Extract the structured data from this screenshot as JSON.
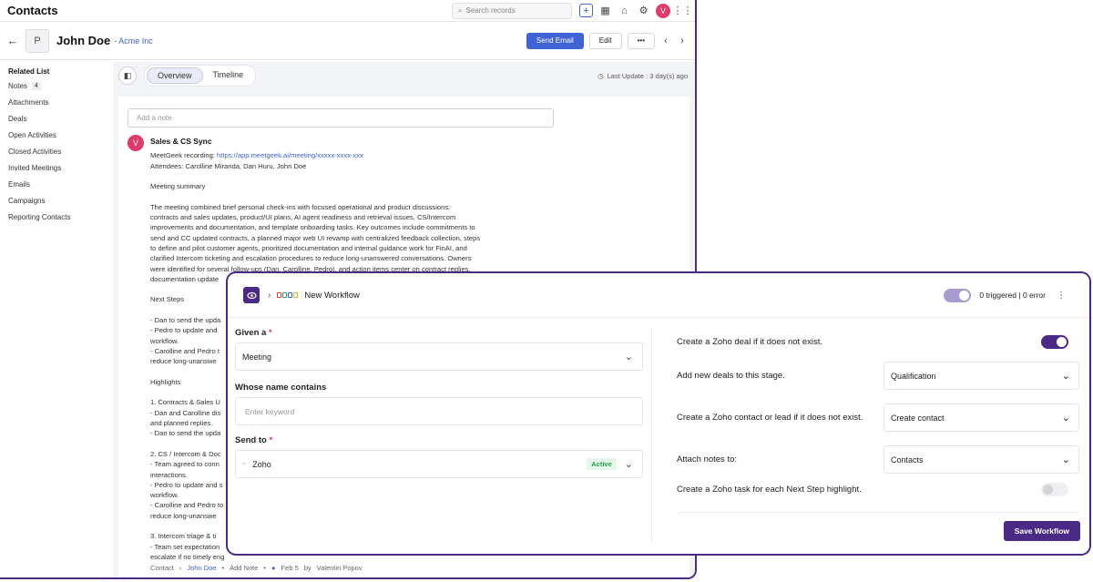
{
  "topbar": {
    "title": "Contacts",
    "search_placeholder": "Search records",
    "avatar_letter": "V"
  },
  "record": {
    "avatar_letter": "P",
    "name": "John Doe",
    "company": "- Acme Inc",
    "send_email": "Send Email",
    "edit": "Edit",
    "more": "•••"
  },
  "sidebar": {
    "title": "Related List",
    "items": [
      {
        "label": "Notes",
        "count": "4"
      },
      {
        "label": "Attachments"
      },
      {
        "label": "Deals"
      },
      {
        "label": "Open Activities"
      },
      {
        "label": "Closed Activities"
      },
      {
        "label": "Invited Meetings"
      },
      {
        "label": "Emails"
      },
      {
        "label": "Campaigns"
      },
      {
        "label": "Reporting Contacts"
      }
    ]
  },
  "tabs": {
    "overview": "Overview",
    "timeline": "Timeline",
    "last_update": "Last Update : 3 day(s) ago"
  },
  "note": {
    "placeholder": "Add a note",
    "avatar_letter": "V",
    "title": "Sales & CS Sync",
    "recording_label": "MeetGeek recording: ",
    "recording_link": "https://app.meetgeek.ai/meeting/xxxxx-xxxx-xxx",
    "attendees": "Attendees: Carolline Miranda, Dan Huru, John Doe",
    "summary_heading": "Meeting summary",
    "summary_lines": [
      "The meeting combined brief personal check-ins with focused operational and product discussions:",
      "contracts and sales updates, product/UI plans, AI agent readiness and retrieval issues, CS/Intercom",
      "improvements and documentation, and template onboarding tasks. Key outcomes include commitments to",
      "send and CC updated contracts, a planned major web UI revamp with centralized feedback collection, steps",
      "to define and pilot customer agents, prioritized documentation and internal guidance work for FinAI, and",
      "clarified Intercom ticketing and escalation procedures to reduce long-unanswered conversations. Owners",
      "were identified for several follow-ups (Dan, Carolline, Pedro), and action items center on contract replies,",
      "documentation update"
    ],
    "next_steps_heading": "Next Steps",
    "next_steps_lines": [
      "- Dan to send the upda",
      "- Pedro to update and",
      "workflow.",
      "- Carolline and Pedro t",
      "reduce long-unanswe"
    ],
    "highlights_heading": "Highlights",
    "highlights_lines": [
      "1. Contracts & Sales U",
      "- Dan and Carolline dis",
      "and planned replies.",
      "- Dan to send the upda",
      "",
      "2. CS / Intercom & Doc",
      "- Team agreed to conn",
      "interactions.",
      "- Pedro to update and s",
      "workflow.",
      "- Carolline and Pedro to",
      "reduce long-unanswe",
      "",
      "3. Intercom triage & ti",
      "- Team set expectation",
      "escalate if no timely eng"
    ],
    "footer": {
      "contact": "Contact",
      "name": "John Doe",
      "add_note": "Add Note",
      "date": "Feb 5",
      "by": "by",
      "author": "Valentin Popov"
    }
  },
  "workflow": {
    "title": "New Workflow",
    "status": "0 triggered | 0 error",
    "given_label": "Given a",
    "given_value": "Meeting",
    "whose_label": "Whose name contains",
    "whose_placeholder": "Enter keyword",
    "send_to_label": "Send to",
    "send_to_value": "Zoho",
    "send_to_badge": "Active",
    "create_deal": "Create a Zoho deal if it does not exist.",
    "add_deals_label": "Add new deals to this stage.",
    "add_deals_value": "Qualification",
    "create_contact_label": "Create a Zoho contact or lead if it does not exist.",
    "create_contact_value": "Create contact",
    "attach_label": "Attach notes to:",
    "attach_value": "Contacts",
    "create_task": "Create a Zoho task for each Next Step highlight.",
    "save": "Save Workflow",
    "required_mark": "*"
  },
  "colors": {
    "accent": "#4a2a86",
    "primary": "#3f63d6",
    "avatar": "#e03a6a",
    "active_green": "#2b9d4a"
  }
}
